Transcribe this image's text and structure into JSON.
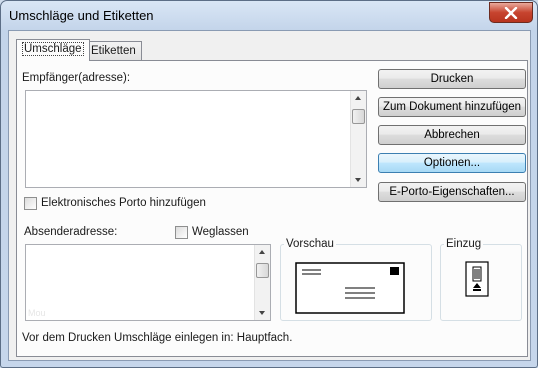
{
  "window": {
    "title": "Umschläge und Etiketten"
  },
  "tabs": [
    {
      "label": "Umschläge",
      "active": true
    },
    {
      "label": "Etiketten",
      "active": false
    }
  ],
  "recipient": {
    "label": "Empfänger(adresse):",
    "value": ""
  },
  "buttons": {
    "print": "Drucken",
    "add_to_document": "Zum Dokument hinzufügen",
    "cancel": "Abbrechen",
    "options": "Optionen...",
    "eporto_properties": "E-Porto-Eigenschaften..."
  },
  "eporto_checkbox": {
    "label": "Elektronisches Porto hinzufügen",
    "checked": false
  },
  "sender": {
    "label": "Absenderadresse:",
    "value": "",
    "watermark": "Mou"
  },
  "omit_checkbox": {
    "label": "Weglassen",
    "checked": false
  },
  "preview": {
    "label": "Vorschau"
  },
  "feed": {
    "label": "Einzug"
  },
  "status": {
    "text": "Vor dem Drucken Umschläge einlegen in: Hauptfach."
  },
  "colors": {
    "focus_accent": "#3c7fb1",
    "close_button": "#c7442f",
    "title_bar": "#c3d4ea"
  },
  "icons": [
    "close-icon",
    "envelope-preview-icon",
    "feed-tray-icon",
    "scroll-up-arrow-icon",
    "scroll-down-arrow-icon"
  ]
}
